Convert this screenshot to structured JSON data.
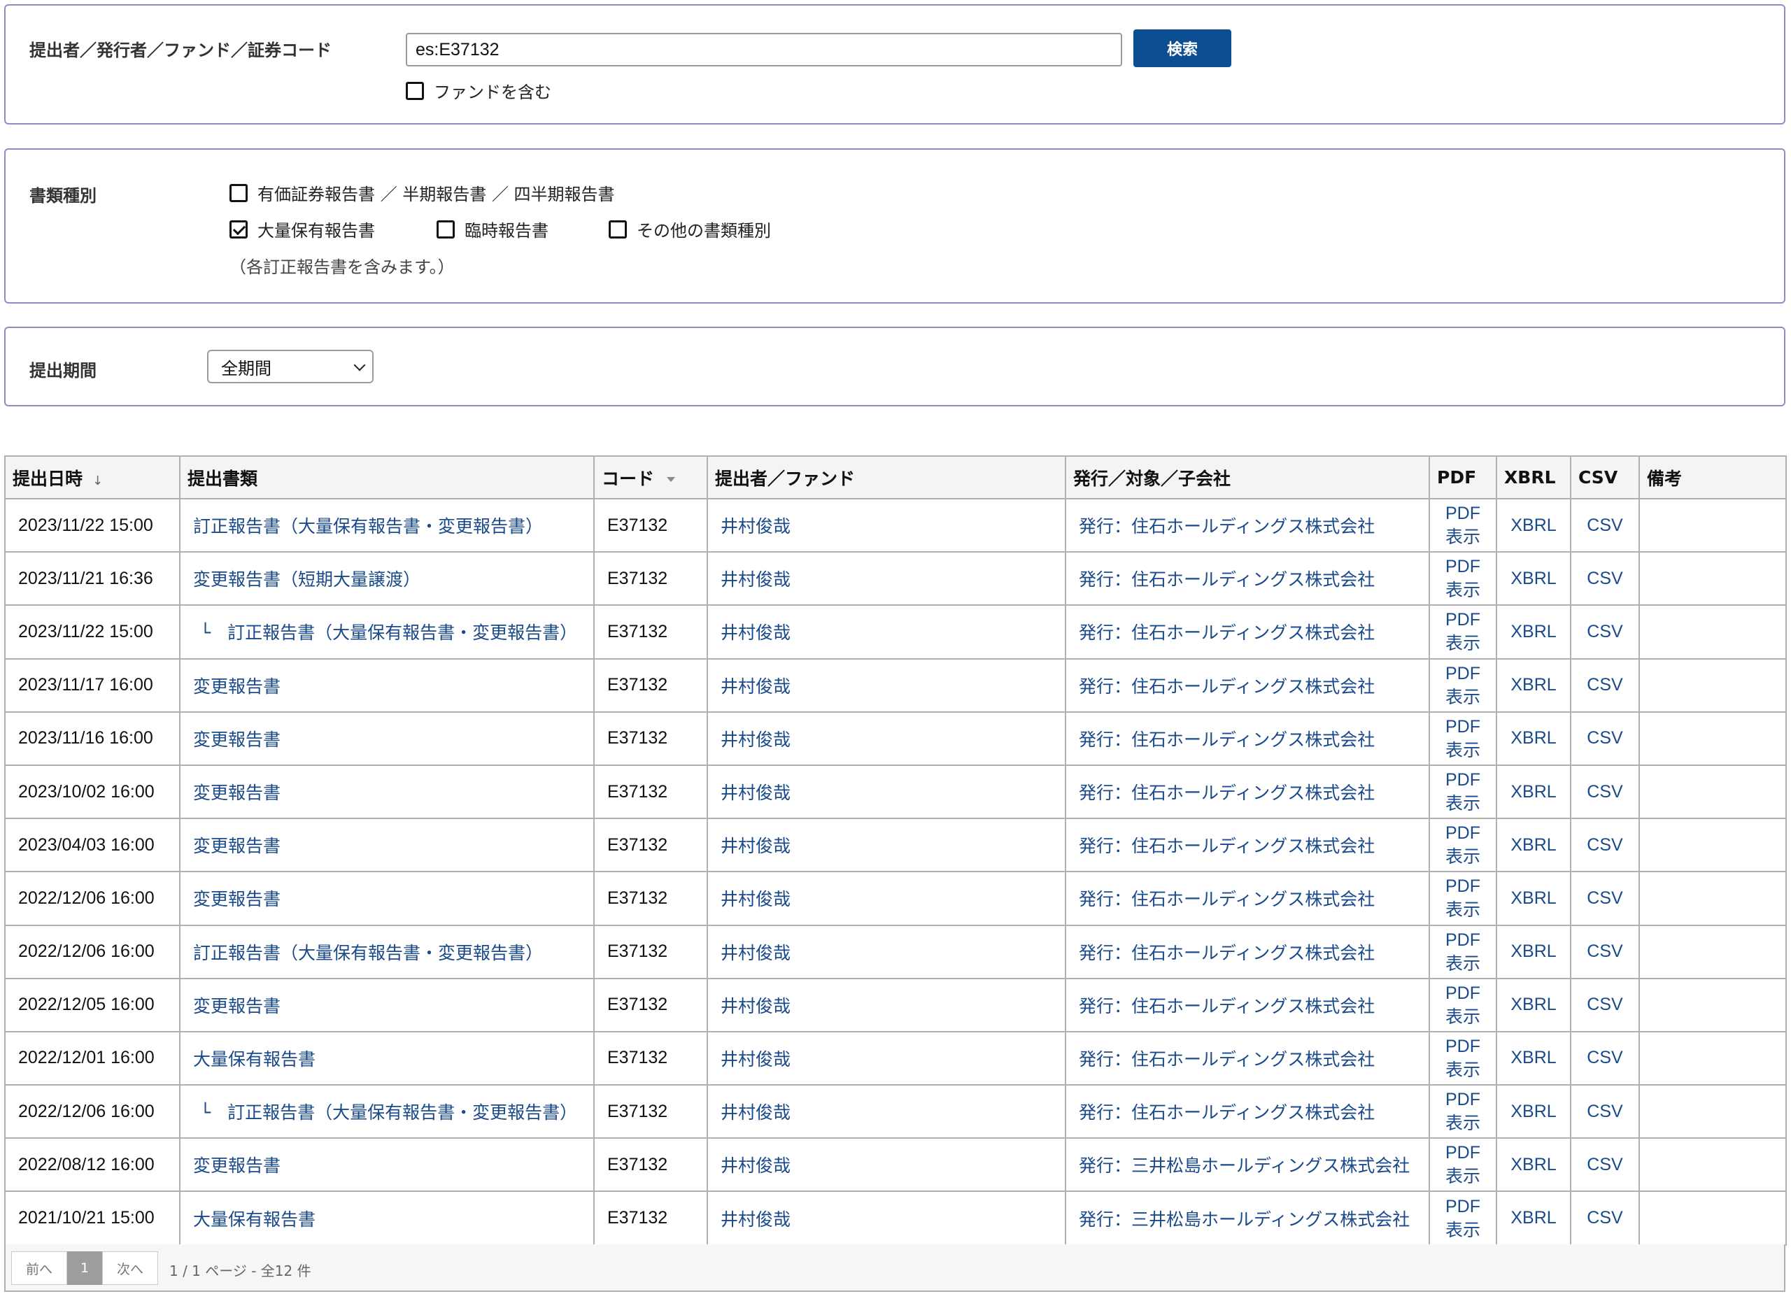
{
  "search": {
    "label": "提出者／発行者／ファンド／証券コード",
    "value": "es:E37132",
    "button": "検索",
    "include_funds_label": "ファンドを含む",
    "include_funds_checked": false
  },
  "doc_types": {
    "label": "書類種別",
    "options": [
      {
        "label": "有価証券報告書 ／ 半期報告書 ／ 四半期報告書",
        "checked": false
      },
      {
        "label": "大量保有報告書",
        "checked": true
      },
      {
        "label": "臨時報告書",
        "checked": false
      },
      {
        "label": "その他の書類種別",
        "checked": false
      }
    ],
    "note": "（各訂正報告書を含みます。）"
  },
  "period": {
    "label": "提出期間",
    "selected": "全期間"
  },
  "table": {
    "headers": {
      "date": "提出日時",
      "date_sort": "↓",
      "doc": "提出書類",
      "code": "コード",
      "filer": "提出者／ファンド",
      "issuer": "発行／対象／子会社",
      "pdf": "PDF",
      "xbrl": "XBRL",
      "csv": "CSV",
      "remarks": "備考"
    },
    "link_labels": {
      "pdf_line1": "PDF",
      "pdf_line2": "表示",
      "xbrl": "XBRL",
      "csv": "CSV"
    },
    "sub_marker": "└",
    "rows": [
      {
        "date": "2023/11/22 15:00",
        "doc": "訂正報告書（大量保有報告書・変更報告書）",
        "sub": false,
        "code": "E37132",
        "filer": "井村俊哉",
        "issuer": "発行：住石ホールディングス株式会社"
      },
      {
        "date": "2023/11/21 16:36",
        "doc": "変更報告書（短期大量譲渡）",
        "sub": false,
        "code": "E37132",
        "filer": "井村俊哉",
        "issuer": "発行：住石ホールディングス株式会社"
      },
      {
        "date": "2023/11/22 15:00",
        "doc": "訂正報告書（大量保有報告書・変更報告書）",
        "sub": true,
        "code": "E37132",
        "filer": "井村俊哉",
        "issuer": "発行：住石ホールディングス株式会社"
      },
      {
        "date": "2023/11/17 16:00",
        "doc": "変更報告書",
        "sub": false,
        "code": "E37132",
        "filer": "井村俊哉",
        "issuer": "発行：住石ホールディングス株式会社"
      },
      {
        "date": "2023/11/16 16:00",
        "doc": "変更報告書",
        "sub": false,
        "code": "E37132",
        "filer": "井村俊哉",
        "issuer": "発行：住石ホールディングス株式会社"
      },
      {
        "date": "2023/10/02 16:00",
        "doc": "変更報告書",
        "sub": false,
        "code": "E37132",
        "filer": "井村俊哉",
        "issuer": "発行：住石ホールディングス株式会社"
      },
      {
        "date": "2023/04/03 16:00",
        "doc": "変更報告書",
        "sub": false,
        "code": "E37132",
        "filer": "井村俊哉",
        "issuer": "発行：住石ホールディングス株式会社"
      },
      {
        "date": "2022/12/06 16:00",
        "doc": "変更報告書",
        "sub": false,
        "code": "E37132",
        "filer": "井村俊哉",
        "issuer": "発行：住石ホールディングス株式会社"
      },
      {
        "date": "2022/12/06 16:00",
        "doc": "訂正報告書（大量保有報告書・変更報告書）",
        "sub": false,
        "code": "E37132",
        "filer": "井村俊哉",
        "issuer": "発行：住石ホールディングス株式会社"
      },
      {
        "date": "2022/12/05 16:00",
        "doc": "変更報告書",
        "sub": false,
        "code": "E37132",
        "filer": "井村俊哉",
        "issuer": "発行：住石ホールディングス株式会社"
      },
      {
        "date": "2022/12/01 16:00",
        "doc": "大量保有報告書",
        "sub": false,
        "code": "E37132",
        "filer": "井村俊哉",
        "issuer": "発行：住石ホールディングス株式会社"
      },
      {
        "date": "2022/12/06 16:00",
        "doc": "訂正報告書（大量保有報告書・変更報告書）",
        "sub": true,
        "code": "E37132",
        "filer": "井村俊哉",
        "issuer": "発行：住石ホールディングス株式会社"
      },
      {
        "date": "2022/08/12 16:00",
        "doc": "変更報告書",
        "sub": false,
        "code": "E37132",
        "filer": "井村俊哉",
        "issuer": "発行：三井松島ホールディングス株式会社"
      },
      {
        "date": "2021/10/21 15:00",
        "doc": "大量保有報告書",
        "sub": false,
        "code": "E37132",
        "filer": "井村俊哉",
        "issuer": "発行：三井松島ホールディングス株式会社"
      }
    ]
  },
  "pager": {
    "prev": "前へ",
    "current": "1",
    "next": "次へ",
    "info": "1 / 1 ページ - 全12 件"
  },
  "colors": {
    "panel_border": "#8c8fc4",
    "button_bg": "#0d4d92",
    "link": "#1a4a8a"
  }
}
